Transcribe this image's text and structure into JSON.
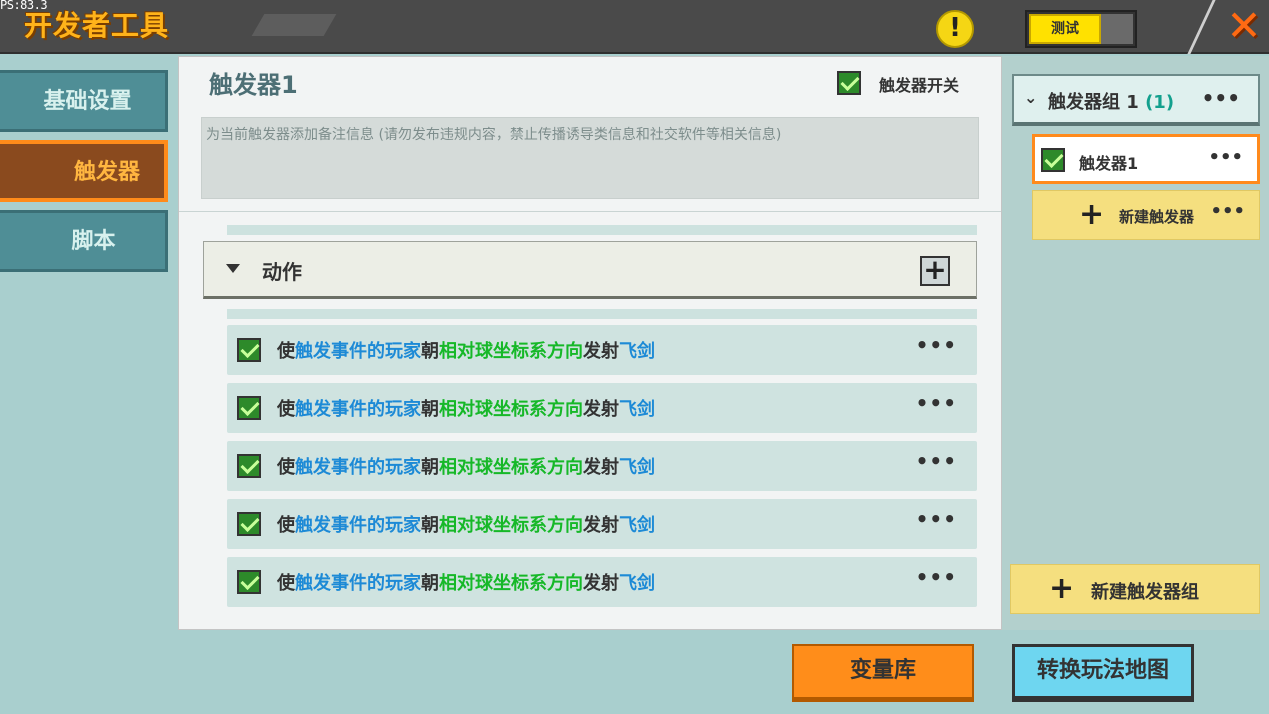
{
  "topbar": {
    "fps": "PS:83.3",
    "title": "开发者工具",
    "warning_icon": "exclamation-icon",
    "test_label": "测试",
    "close_icon": "close-icon"
  },
  "nav": {
    "items": [
      {
        "label": "基础设置",
        "active": false
      },
      {
        "label": "触发器",
        "active": true
      },
      {
        "label": "脚本",
        "active": false
      }
    ]
  },
  "trigger": {
    "name": "触发器1",
    "switch_label": "触发器开关",
    "switch_on": true,
    "note_placeholder": "为当前触发器添加备注信息 (请勿发布违规内容，禁止传播诱导类信息和社交软件等相关信息)"
  },
  "actions_section": {
    "label": "动作",
    "rows": [
      {
        "p1": "使",
        "p2": "触发事件的玩家",
        "p3": "朝",
        "p4": "相对球坐标系方向",
        "p5": "发射",
        "p6": "飞剑"
      },
      {
        "p1": "使",
        "p2": "触发事件的玩家",
        "p3": "朝",
        "p4": "相对球坐标系方向",
        "p5": "发射",
        "p6": "飞剑"
      },
      {
        "p1": "使",
        "p2": "触发事件的玩家",
        "p3": "朝",
        "p4": "相对球坐标系方向",
        "p5": "发射",
        "p6": "飞剑"
      },
      {
        "p1": "使",
        "p2": "触发事件的玩家",
        "p3": "朝",
        "p4": "相对球坐标系方向",
        "p5": "发射",
        "p6": "飞剑"
      },
      {
        "p1": "使",
        "p2": "触发事件的玩家",
        "p3": "朝",
        "p4": "相对球坐标系方向",
        "p5": "发射",
        "p6": "飞剑"
      }
    ],
    "more": "•••"
  },
  "right_panel": {
    "group_name": "触发器组 1",
    "group_count": "(1)",
    "more": "•••",
    "trigger_item": "触发器1",
    "new_trigger": "新建触发器",
    "new_group": "新建触发器组",
    "plus": "+"
  },
  "bottom": {
    "variables": "变量库",
    "convert_map": "转换玩法地图"
  },
  "colors": {
    "accent_orange": "#ff8d1a",
    "keyword_blue": "#1d8ad6",
    "keyword_green": "#16b828"
  }
}
